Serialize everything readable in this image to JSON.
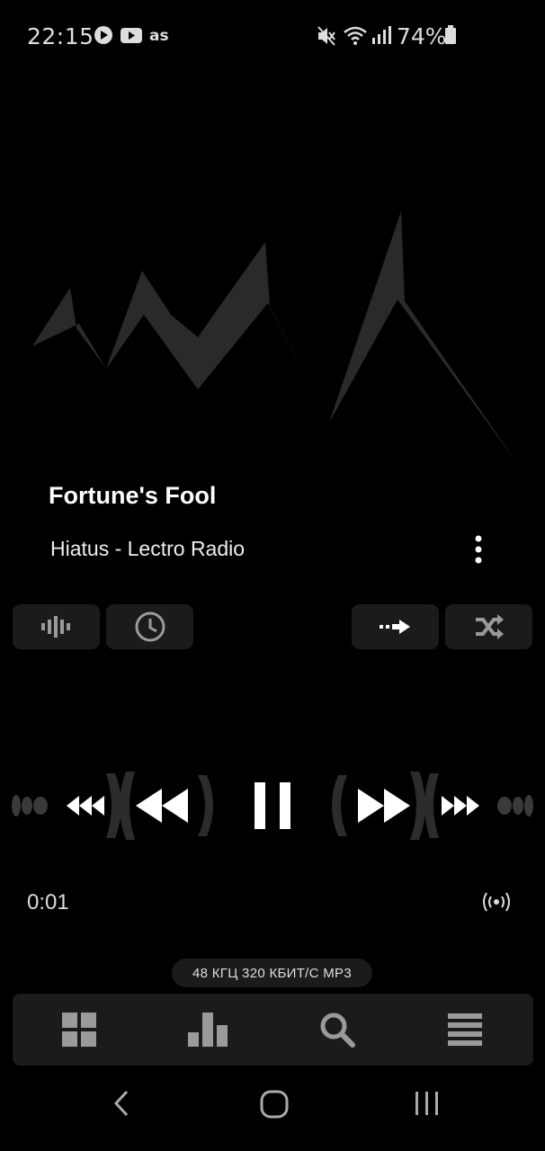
{
  "status_bar": {
    "time": "22:15",
    "battery": "74%",
    "icons": [
      "play-store-icon",
      "youtube-icon",
      "lastfm-icon",
      "mute-icon",
      "wifi-icon",
      "signal-icon",
      "battery-icon"
    ]
  },
  "track": {
    "title": "Fortune's Fool",
    "subtitle": "Hiatus - Lectro Radio"
  },
  "controls": {
    "left_pills": [
      "waveform-icon",
      "clock-icon"
    ],
    "right_pills": [
      "repeat-arrow-icon",
      "shuffle-icon"
    ],
    "elapsed": "0:01",
    "format": "48 КГЦ  320 КБИТ/С  MP3"
  },
  "bottom_nav": [
    "grid-icon",
    "bar-chart-icon",
    "search-icon",
    "list-icon"
  ],
  "colors": {
    "background": "#000000",
    "surface": "#1b1b1b",
    "icon": "#9a9a9a",
    "art": "#2a2a2a"
  }
}
